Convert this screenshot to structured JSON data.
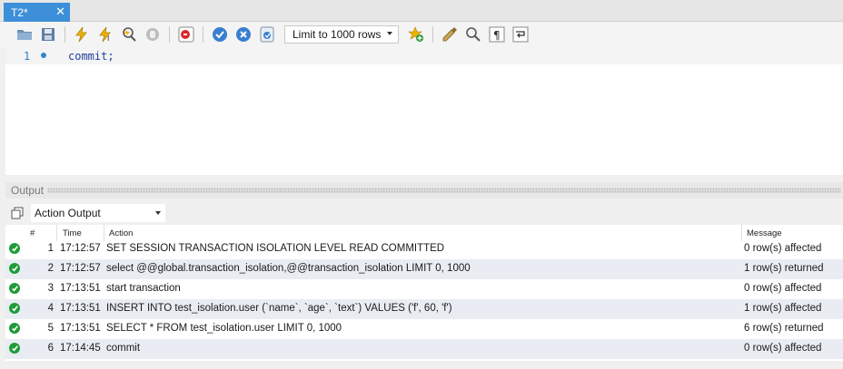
{
  "tab": {
    "title": "T2*",
    "close": "✕"
  },
  "toolbar": {
    "limit_select": "Limit to 1000 rows",
    "icons": [
      "open-folder-icon",
      "save-icon",
      "execute-icon",
      "execute-current-icon",
      "explain-icon",
      "stop-icon",
      "toggle-error-icon",
      "commit-icon",
      "rollback-icon",
      "autocommit-icon",
      "add-snippet-icon",
      "beautify-icon",
      "find-icon",
      "invisible-chars-icon",
      "wrap-icon"
    ]
  },
  "editor": {
    "lines": [
      {
        "number": "1",
        "code": "commit;"
      }
    ]
  },
  "output": {
    "label": "Output",
    "selector": "Action Output",
    "columns": {
      "num": "#",
      "time": "Time",
      "action": "Action",
      "message": "Message"
    },
    "rows": [
      {
        "num": "1",
        "time": "17:12:57",
        "action": "SET SESSION TRANSACTION ISOLATION LEVEL READ COMMITTED",
        "message": "0 row(s) affected"
      },
      {
        "num": "2",
        "time": "17:12:57",
        "action": "select @@global.transaction_isolation,@@transaction_isolation LIMIT 0, 1000",
        "message": "1 row(s) returned"
      },
      {
        "num": "3",
        "time": "17:13:51",
        "action": "start transaction",
        "message": "0 row(s) affected"
      },
      {
        "num": "4",
        "time": "17:13:51",
        "action": "INSERT INTO test_isolation.user (`name`, `age`, `text`) VALUES ('f', 60, 'f')",
        "message": "1 row(s) affected"
      },
      {
        "num": "5",
        "time": "17:13:51",
        "action": "SELECT * FROM test_isolation.user LIMIT 0, 1000",
        "message": "6 row(s) returned"
      },
      {
        "num": "6",
        "time": "17:14:45",
        "action": "commit",
        "message": "0 row(s) affected"
      }
    ]
  }
}
